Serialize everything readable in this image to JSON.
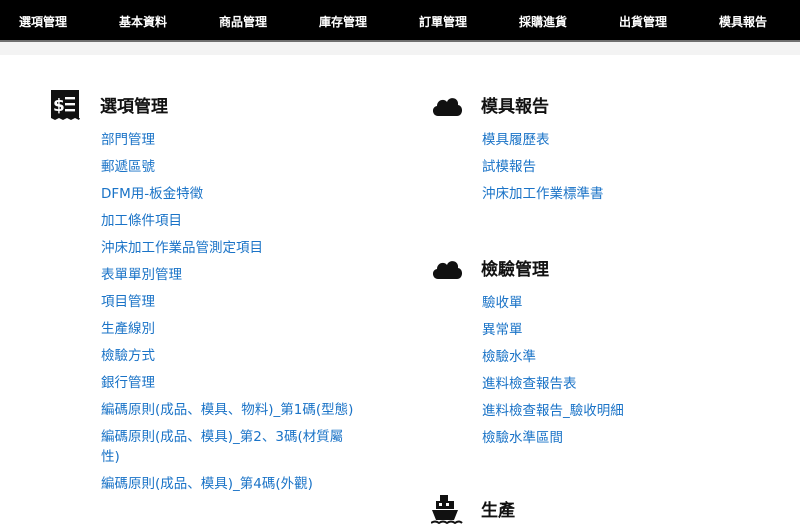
{
  "nav": {
    "items": [
      "選項管理",
      "基本資料",
      "商品管理",
      "庫存管理",
      "訂單管理",
      "採購進貨",
      "出貨管理",
      "模具報告"
    ]
  },
  "sections": {
    "options": {
      "title": "選項管理",
      "icon": "receipt-dollar-icon",
      "links": [
        "部門管理",
        "郵遞區號",
        "DFM用-板金特徵",
        "加工條件項目",
        "沖床加工作業品管測定項目",
        "表單單別管理",
        "項目管理",
        "生產線別",
        "檢驗方式",
        "銀行管理",
        "編碼原則(成品、模具、物料)_第1碼(型態)",
        "編碼原則(成品、模具)_第2、3碼(材質屬性)",
        "編碼原則(成品、模具)_第4碼(外觀)"
      ]
    },
    "mold": {
      "title": "模具報告",
      "icon": "cloud-icon",
      "links": [
        "模具履歷表",
        "試模報告",
        "沖床加工作業標準書"
      ]
    },
    "inspection": {
      "title": "檢驗管理",
      "icon": "cloud-icon",
      "links": [
        "驗收單",
        "異常單",
        "檢驗水準",
        "進料檢查報告表",
        "進料檢查報告_驗收明細",
        "檢驗水準區間"
      ]
    },
    "production": {
      "title": "生產",
      "icon": "ship-icon"
    }
  },
  "colors": {
    "nav_bg": "#000000",
    "link": "#1a73c7",
    "heading": "#111111"
  }
}
